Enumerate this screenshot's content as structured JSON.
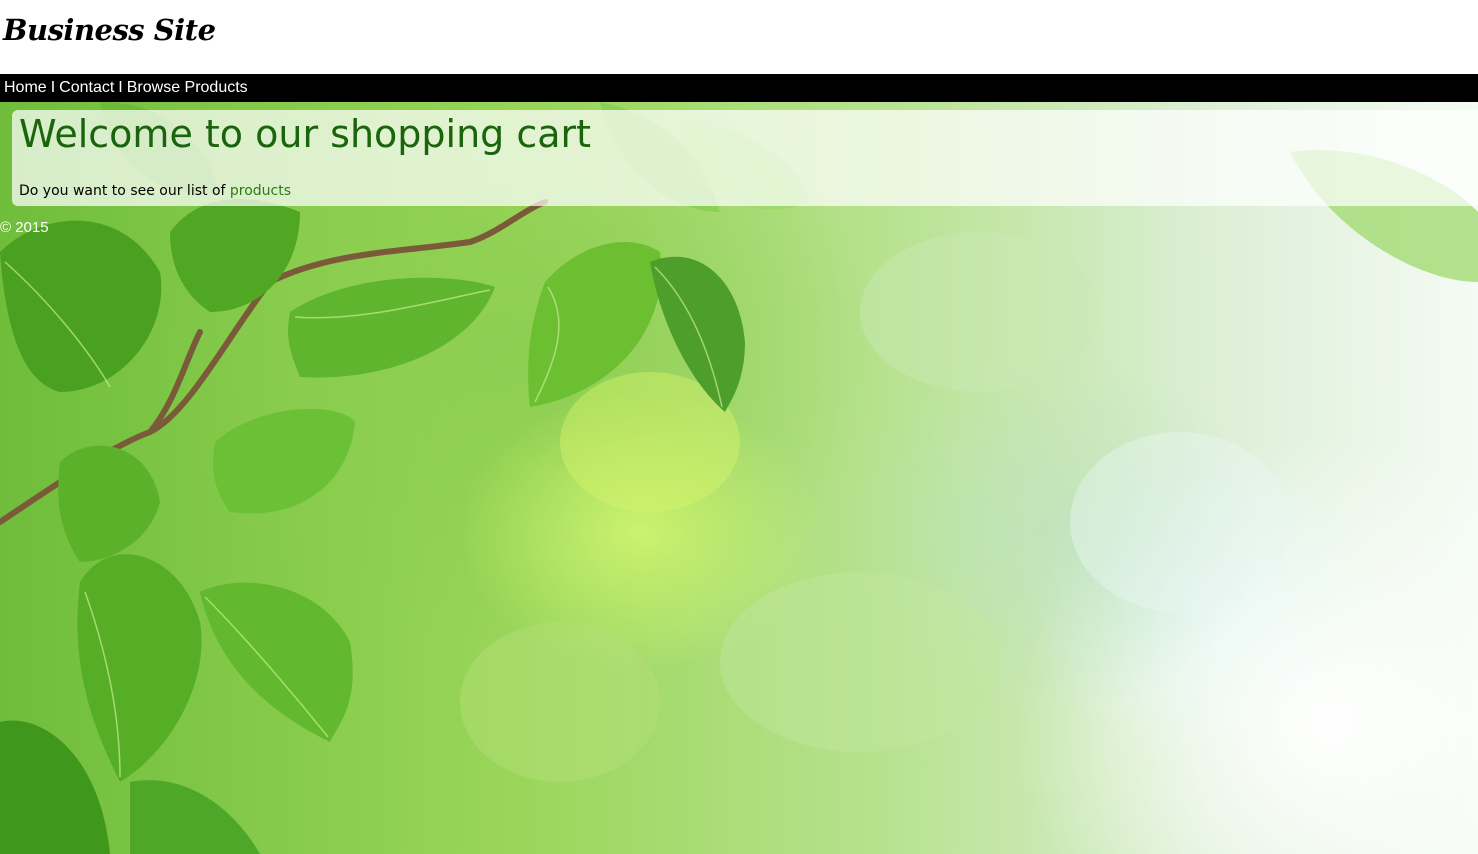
{
  "header": {
    "site_title": "Business Site"
  },
  "nav": {
    "items": [
      {
        "label": "Home"
      },
      {
        "label": "Contact"
      },
      {
        "label": "Browse Products"
      }
    ],
    "separator": "I"
  },
  "main": {
    "heading": "Welcome to our shopping cart",
    "text_prefix": "Do you want to see our list of ",
    "link_label": "products"
  },
  "footer": {
    "text": "© 2015"
  },
  "colors": {
    "nav_background": "#000000",
    "heading_green": "#19640d",
    "link_green": "#2e7a14"
  },
  "background": {
    "image_icon": "green-leaves-background-image"
  }
}
